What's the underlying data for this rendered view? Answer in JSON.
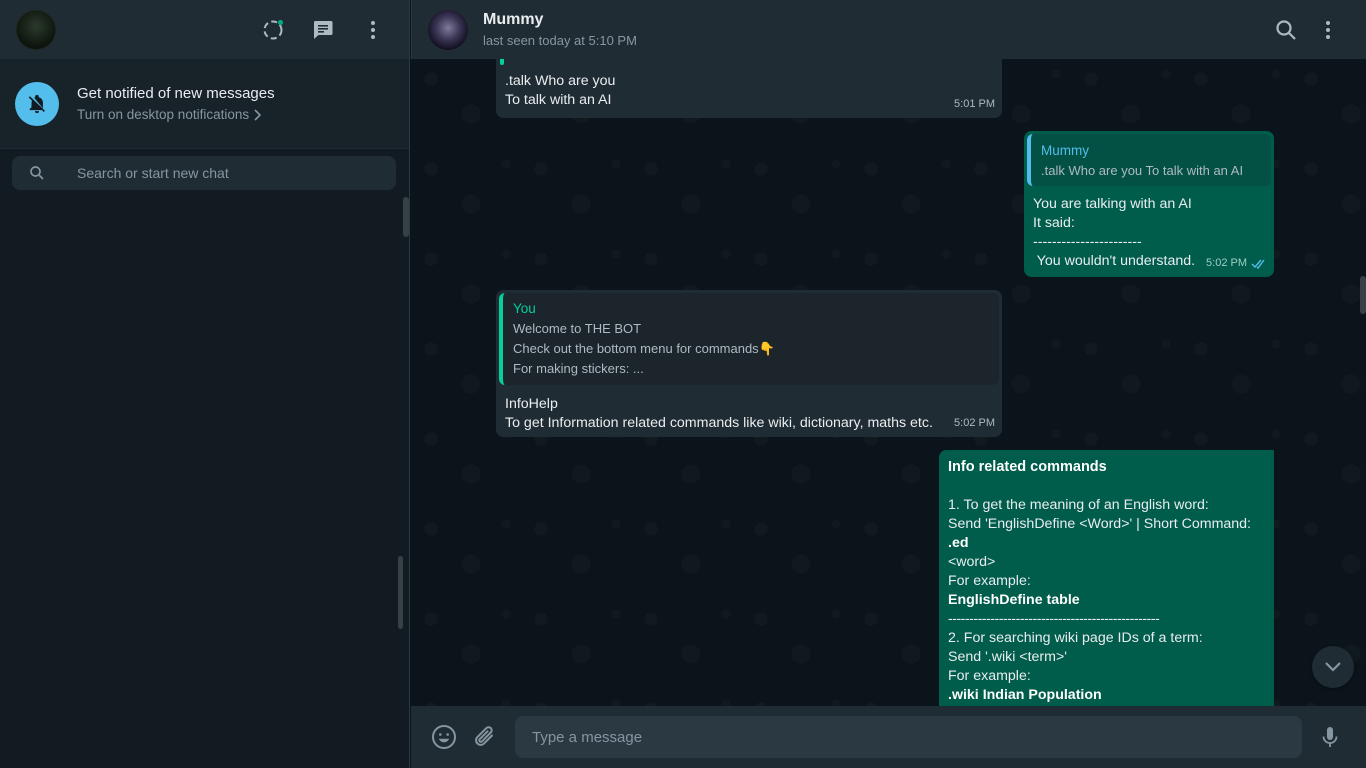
{
  "left": {
    "notification": {
      "title": "Get notified of new messages",
      "subtitle": "Turn on desktop notifications"
    },
    "search": {
      "placeholder": "Search or start new chat"
    }
  },
  "chat": {
    "contact_name": "Mummy",
    "status": "last seen today at 5:10 PM",
    "composer_placeholder": "Type a message"
  },
  "messages": [
    {
      "direction": "incoming",
      "lines": [
        ".talk Who are you",
        "To talk with an AI"
      ],
      "time": "5:01 PM"
    },
    {
      "direction": "outgoing",
      "quote_author": "Mummy",
      "quote_text": ".talk Who are you To talk with an AI",
      "lines": [
        "You are talking with an AI",
        "It said:",
        "-----------------------",
        " You wouldn't understand."
      ],
      "time": "5:02 PM",
      "read": true
    },
    {
      "direction": "incoming",
      "quote_author": "You",
      "quote_lines": [
        "Welcome to THE BOT",
        "Check out the bottom menu for commands👇",
        "For making stickers: ..."
      ],
      "lines": [
        "InfoHelp",
        "To get Information related commands like wiki, dictionary, maths etc."
      ],
      "time": "5:02 PM"
    },
    {
      "direction": "outgoing",
      "heading": "Info related commands",
      "lines": [
        "1. To get the meaning of an English word:",
        "Send 'EnglishDefine <Word>' | Short Command: ",
        ".ed",
        "<word>",
        "For example:",
        "EnglishDefine table",
        "--------------------------------------------------",
        "2. For searching wiki page IDs of a term:",
        "Send '.wiki <term>'",
        "For example:",
        ".wiki Indian Population",
        "--------------------------------------------------"
      ]
    }
  ],
  "colors": {
    "outgoing_bubble": "#005c4b",
    "incoming_bubble": "#202c33",
    "accent": "#06cf9c",
    "read_tick": "#53bdeb"
  }
}
